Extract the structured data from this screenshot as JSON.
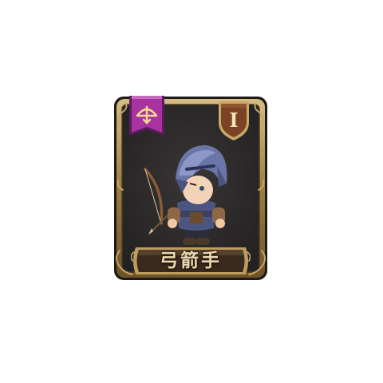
{
  "unit": {
    "name": "弓箭手",
    "rank_numeral": "I",
    "class_icon": "bow-icon"
  },
  "colors": {
    "frame_gold": "#a8874d",
    "frame_dark": "#2a2522",
    "card_background": "#2d2b2b",
    "ribbon_purple": "#9b2c9e",
    "badge_brown": "#6a3a20",
    "armor_blue": "#5a6596"
  }
}
